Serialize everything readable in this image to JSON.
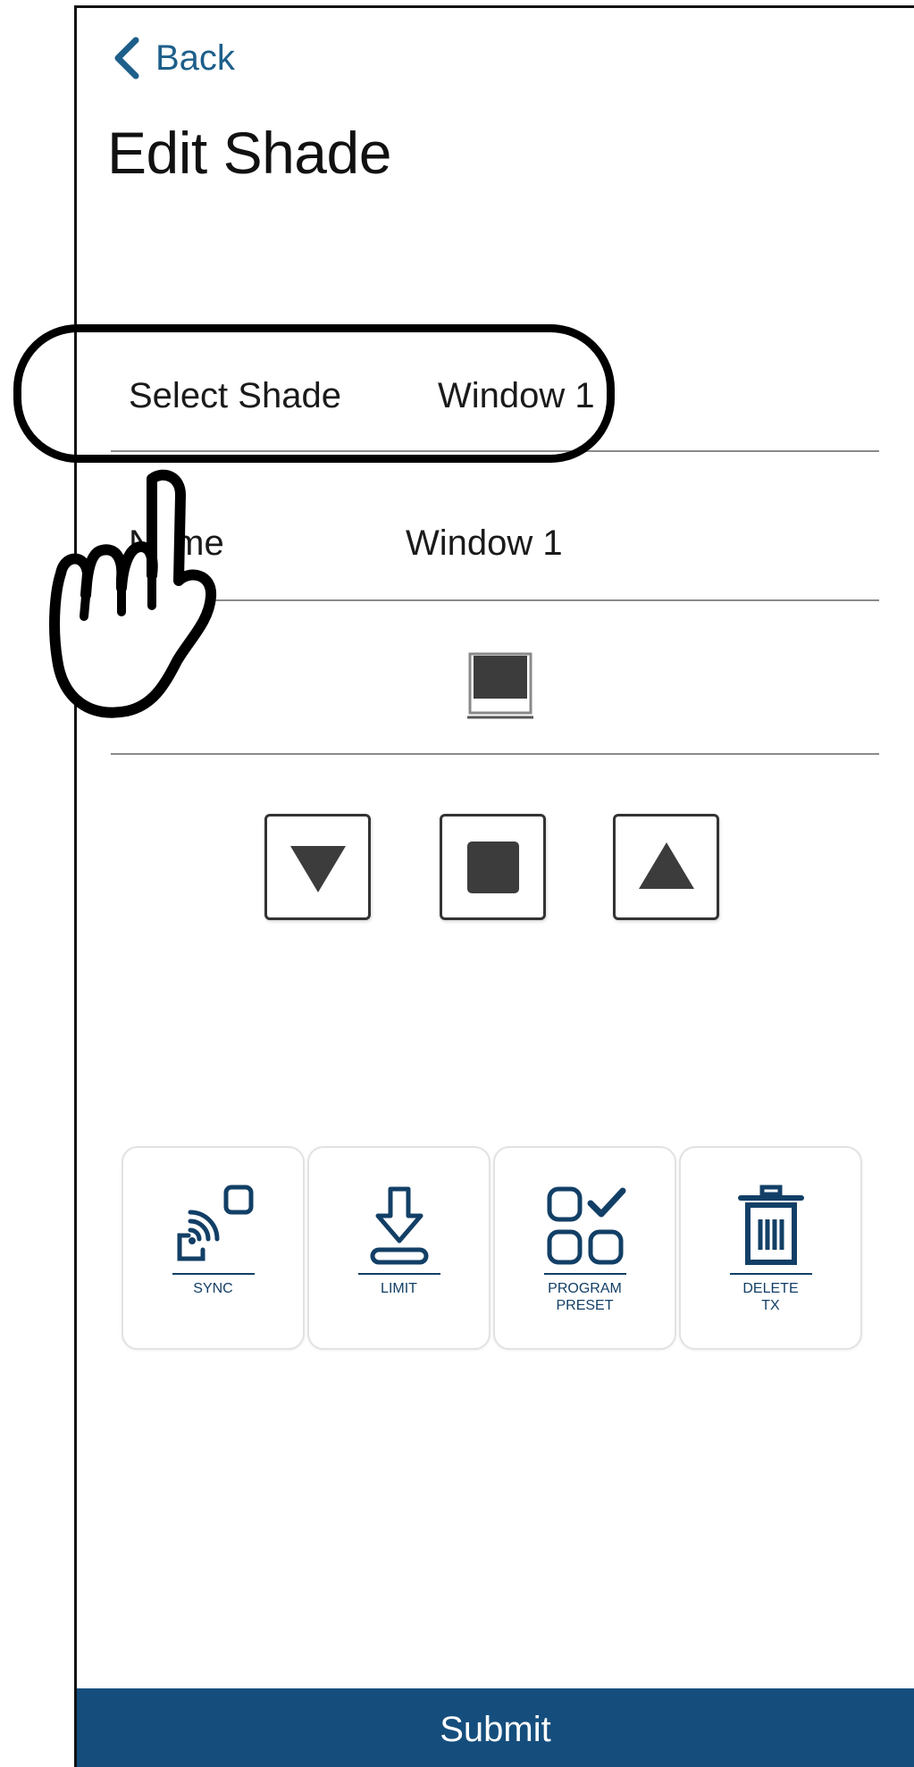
{
  "header": {
    "back_label": "Back",
    "title": "Edit Shade"
  },
  "form": {
    "select_shade": {
      "label": "Select Shade",
      "value": "Window 1"
    },
    "name": {
      "label": "Name",
      "value": "Window 1"
    },
    "shade_icon": "window-shade-icon"
  },
  "controls": {
    "down": "triangle-down-icon",
    "stop": "square-stop-icon",
    "up": "triangle-up-icon"
  },
  "actions": [
    {
      "label": "SYNC",
      "icon": "sync-icon"
    },
    {
      "label": "LIMIT",
      "icon": "limit-icon"
    },
    {
      "label": "PROGRAM\nPRESET",
      "icon": "program-preset-icon"
    },
    {
      "label": "DELETE\nTX",
      "icon": "delete-tx-icon"
    }
  ],
  "footer": {
    "submit_label": "Submit"
  },
  "colors": {
    "accent": "#154e7d",
    "link": "#1d5f8a",
    "icon": "#123f66"
  },
  "overlay": {
    "callout": "highlight-oval",
    "pointer": "pointing-hand-icon"
  }
}
